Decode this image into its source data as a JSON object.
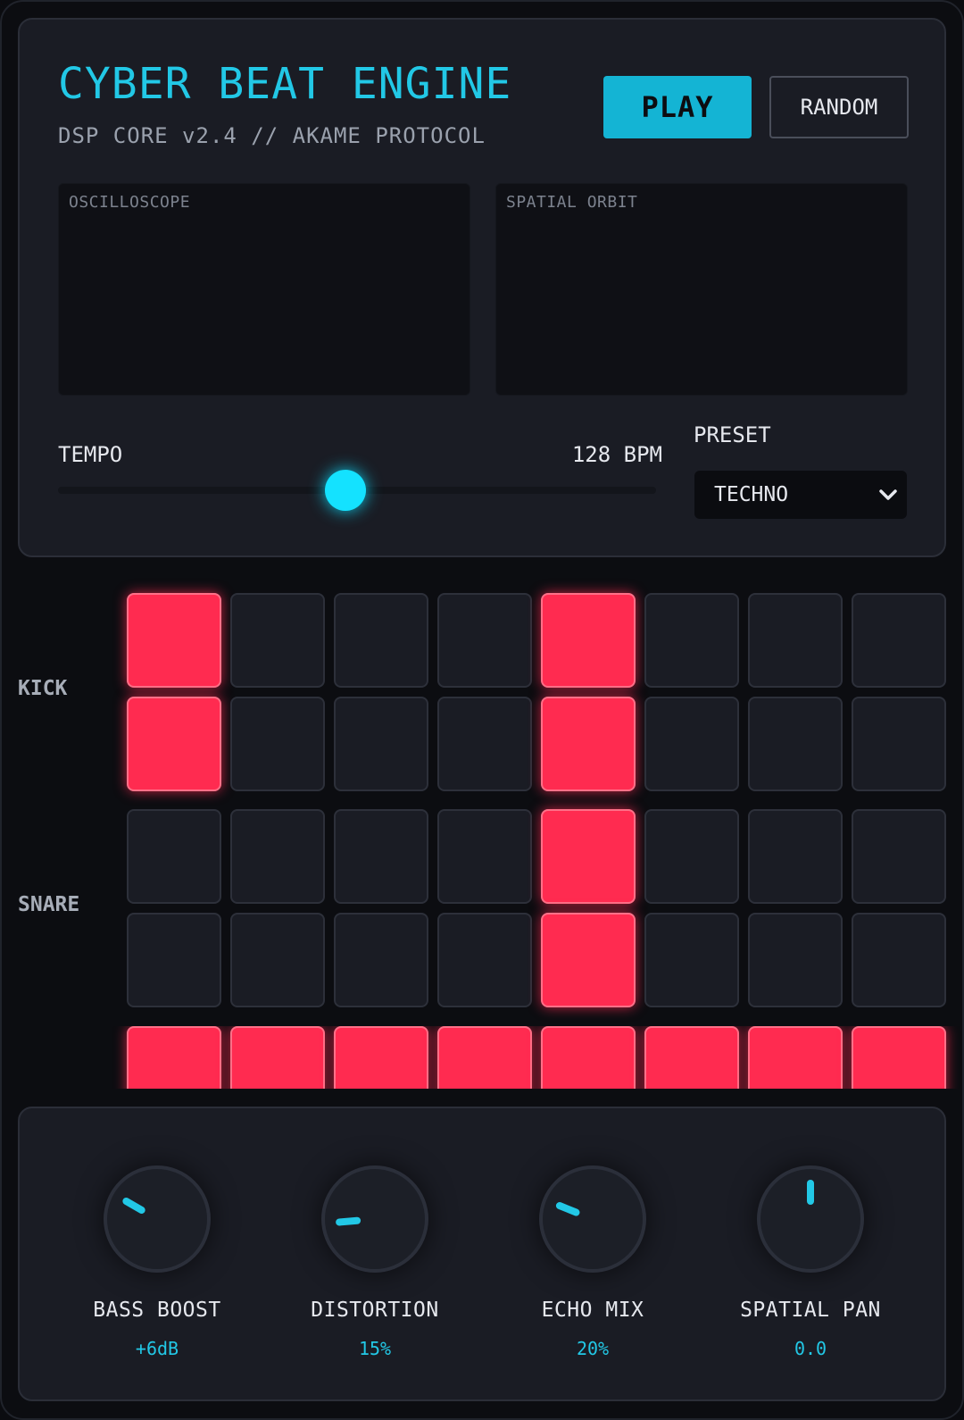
{
  "header": {
    "title": "CYBER BEAT ENGINE",
    "subtitle": "DSP CORE v2.4 // AKAME PROTOCOL",
    "play_label": "PLAY",
    "random_label": "RANDOM"
  },
  "visualizers": {
    "left_label": "OSCILLOSCOPE",
    "right_label": "SPATIAL ORBIT"
  },
  "tempo": {
    "label": "TEMPO",
    "value_text": "128 BPM",
    "slider_fraction": 0.48
  },
  "preset": {
    "label": "PRESET",
    "selected": "TECHNO"
  },
  "sequencer": {
    "rows": [
      {
        "label": "KICK",
        "steps": [
          [
            1,
            0,
            0,
            0,
            1,
            0,
            0,
            0
          ],
          [
            1,
            0,
            0,
            0,
            1,
            0,
            0,
            0
          ]
        ]
      },
      {
        "label": "SNARE",
        "steps": [
          [
            0,
            0,
            0,
            0,
            1,
            0,
            0,
            0
          ],
          [
            0,
            0,
            0,
            0,
            1,
            0,
            0,
            0
          ]
        ]
      },
      {
        "label": "",
        "steps": [
          [
            1,
            1,
            1,
            1,
            1,
            1,
            1,
            1
          ]
        ]
      }
    ]
  },
  "knobs": [
    {
      "label": "BASS BOOST",
      "value": "+6dB"
    },
    {
      "label": "DISTORTION",
      "value": "15%"
    },
    {
      "label": "ECHO MIX",
      "value": "20%"
    },
    {
      "label": "SPATIAL PAN",
      "value": "0.0"
    }
  ],
  "colors": {
    "accent": "#22c8e6",
    "pad_active": "#ff2b50",
    "panel": "#1a1c24"
  }
}
